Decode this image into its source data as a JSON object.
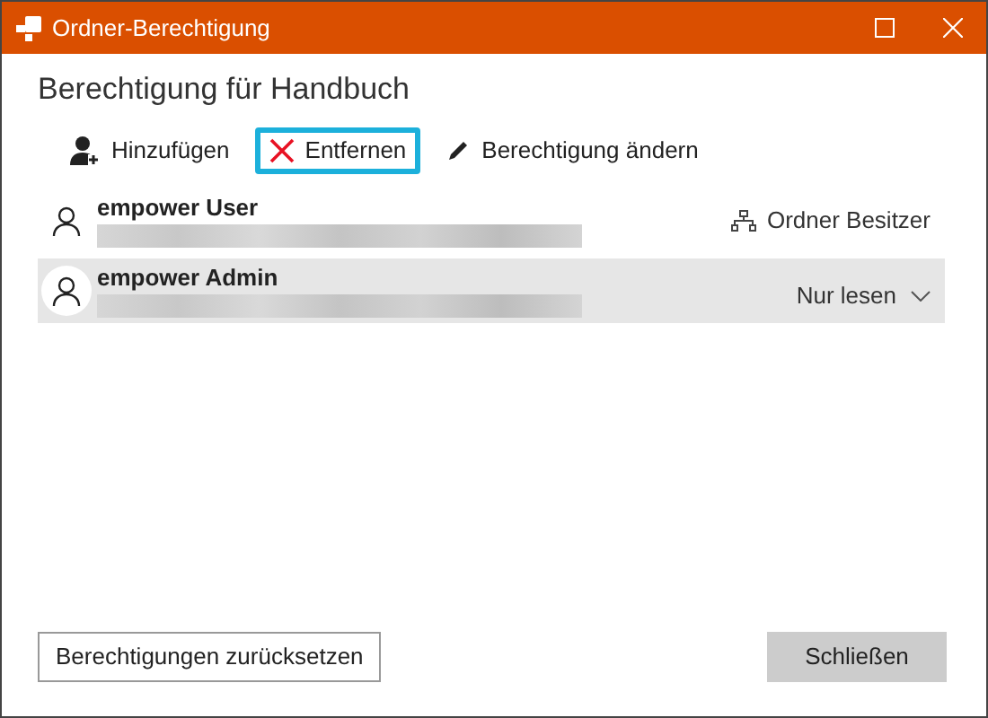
{
  "window": {
    "title": "Ordner-Berechtigung"
  },
  "heading": "Berechtigung für Handbuch",
  "toolbar": [
    {
      "kind": "add",
      "label": "Hinzufügen",
      "focused": false
    },
    {
      "kind": "remove",
      "label": "Entfernen",
      "focused": true
    },
    {
      "kind": "edit",
      "label": "Berechtigung ändern",
      "focused": false
    }
  ],
  "users": [
    {
      "name": "empower User",
      "selected": false,
      "kind": "owner",
      "right": "Ordner Besitzer"
    },
    {
      "name": "empower Admin",
      "selected": true,
      "kind": "permission",
      "right": "Nur lesen"
    }
  ],
  "buttons": [
    {
      "label": "Berechtigungen zurücksetzen",
      "kind": "secondary"
    },
    {
      "label": "Schließen",
      "kind": "primary"
    }
  ]
}
